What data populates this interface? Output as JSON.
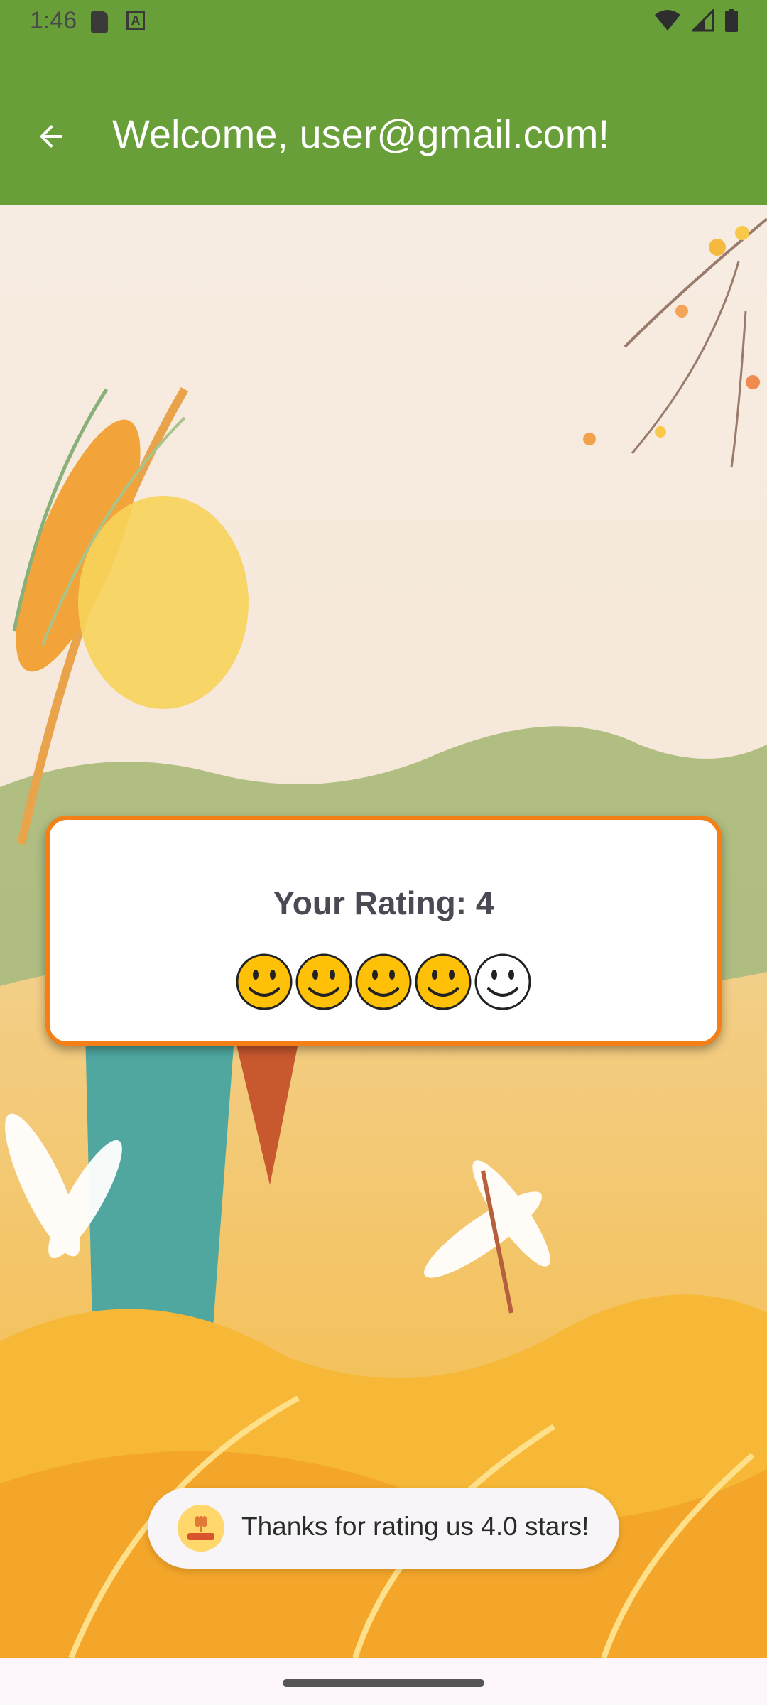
{
  "status_bar": {
    "time": "1:46",
    "icons": [
      "sd-card-icon",
      "a-notification-icon",
      "wifi-icon",
      "signal-icon",
      "battery-icon"
    ]
  },
  "app_bar": {
    "back_icon": "arrow-back-icon",
    "title": "Welcome, user@gmail.com!",
    "color": "#689f38"
  },
  "rating_card": {
    "label": "Your Rating: 4",
    "rating": 4,
    "max": 5,
    "border_color": "#f57f17",
    "filled_color": "#ffc107"
  },
  "toast": {
    "icon": "app-logo-icon",
    "message": "Thanks for rating us 4.0 stars!"
  }
}
